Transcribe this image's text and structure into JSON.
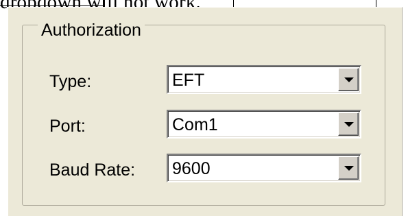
{
  "header_fragment": {
    "text": "dropdown will not work."
  },
  "authorization": {
    "legend": "Authorization",
    "fields": [
      {
        "label": "Type:",
        "value": "EFT",
        "icon": "chevron-down-icon"
      },
      {
        "label": "Port:",
        "value": "Com1",
        "icon": "chevron-down-icon"
      },
      {
        "label": "Baud Rate:",
        "value": "9600",
        "icon": "chevron-down-icon"
      }
    ]
  },
  "colors": {
    "panel_bg": "#ECE9D8",
    "group_border": "#ACA899",
    "button_face": "#D4D0C8"
  }
}
